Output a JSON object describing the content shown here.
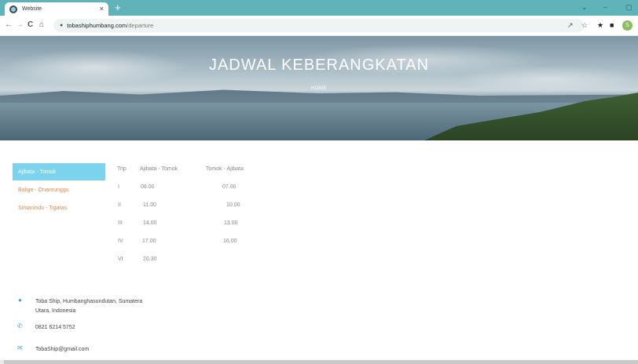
{
  "browser": {
    "tab_title": "Website",
    "tab_close": "×",
    "new_tab": "+",
    "url_host": "tobashiphumbang.com",
    "url_path": "/departure",
    "window_controls": [
      "⌄",
      "–",
      "▢"
    ],
    "nav": {
      "back": "←",
      "forward": "→",
      "reload": "C",
      "home": "⌂"
    },
    "profile_initial": "S"
  },
  "hero": {
    "title": "JADWAL KEBERANGKATAN",
    "breadcrumb": "HOME"
  },
  "routes": [
    {
      "label": "Ajibata - Tomok",
      "active": true
    },
    {
      "label": "Balige - Onanrunggu",
      "active": false
    },
    {
      "label": "Simanindo - Tigaras",
      "active": false
    }
  ],
  "schedule": {
    "headers": [
      "Trip",
      "Ajibata - Tomok",
      "Tomok - Ajibata"
    ],
    "rows": [
      {
        "trip": "I",
        "out": "08.00",
        "back": "07.00"
      },
      {
        "trip": "II",
        "out": "11.00",
        "back": "10.00"
      },
      {
        "trip": "III",
        "out": "14.00",
        "back": "13.00"
      },
      {
        "trip": "IV",
        "out": "17.00",
        "back": "16.00"
      },
      {
        "trip": "VI",
        "out": "20.30",
        "back": ""
      }
    ]
  },
  "footer": {
    "address_line1": "Toba Ship, Humbanghasundutan, Sumatera",
    "address_line2": "Utara, Indonesia",
    "phone": "0821 6214 5752",
    "email": "TobaShip@gmail.com"
  },
  "colors": {
    "tab_strip": "#5fb3b9",
    "active_route": "#7bd3ee",
    "route_text": "#d88a4a",
    "footer_icon": "#3aa8d8"
  }
}
